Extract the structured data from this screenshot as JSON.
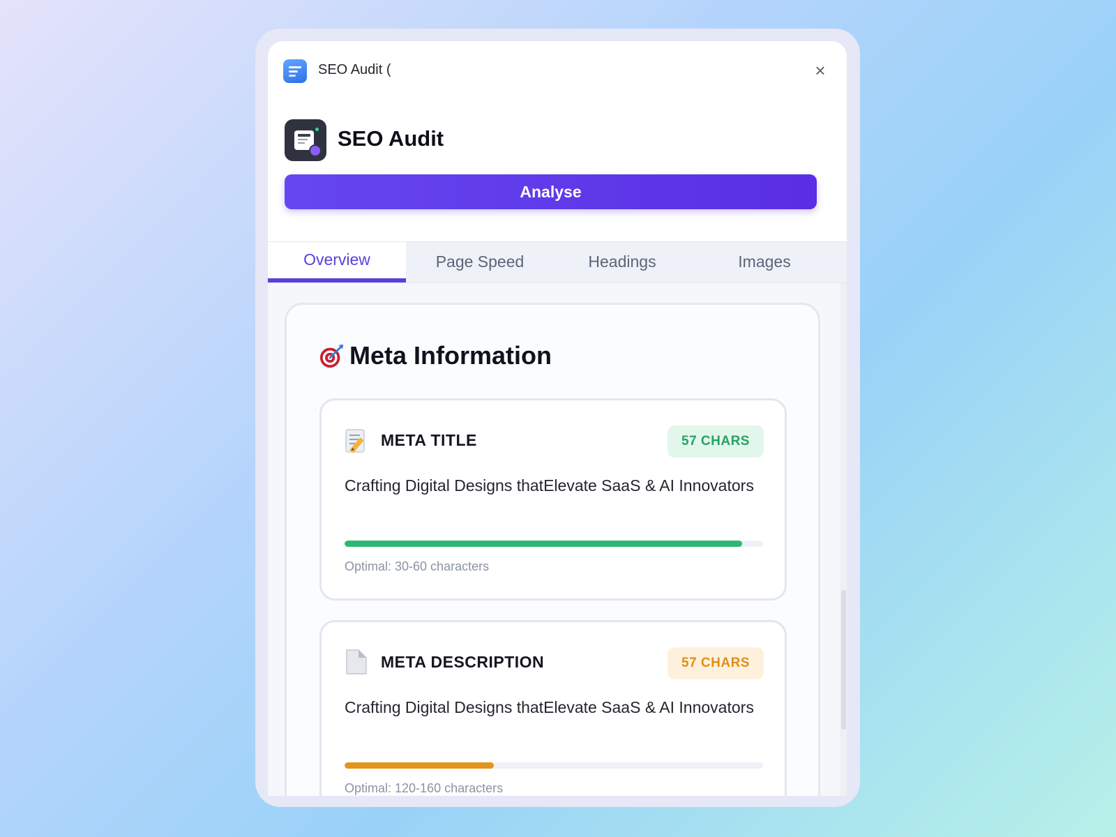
{
  "window": {
    "title": "SEO Audit ("
  },
  "header": {
    "title": "SEO Audit",
    "analyse_label": "Analyse"
  },
  "tabs": [
    {
      "label": "Overview",
      "active": true
    },
    {
      "label": "Page Speed",
      "active": false
    },
    {
      "label": "Headings",
      "active": false
    },
    {
      "label": "Images",
      "active": false
    }
  ],
  "meta_section": {
    "heading": "Meta Information",
    "heading_icon": "target-icon",
    "title_card": {
      "icon": "memo-icon",
      "label": "META TITLE",
      "badge": "57 CHARS",
      "badge_color": "#27a265",
      "text": "Crafting Digital Designs thatElevate SaaS & AI Innovators",
      "progress_fraction": 0.95,
      "progress_color": "#2fb872",
      "optimal": "Optimal: 30-60 characters"
    },
    "description_card": {
      "icon": "document-icon",
      "label": "META DESCRIPTION",
      "badge": "57 CHARS",
      "badge_color": "#e08f16",
      "text": "Crafting Digital Designs thatElevate SaaS & AI Innovators",
      "progress_fraction": 0.357,
      "progress_color": "#e4951b",
      "optimal": "Optimal: 120-160 characters"
    }
  },
  "colors": {
    "accent": "#5a3fd9",
    "button_gradient_start": "#6647ef",
    "button_gradient_end": "#5a2ee4"
  }
}
